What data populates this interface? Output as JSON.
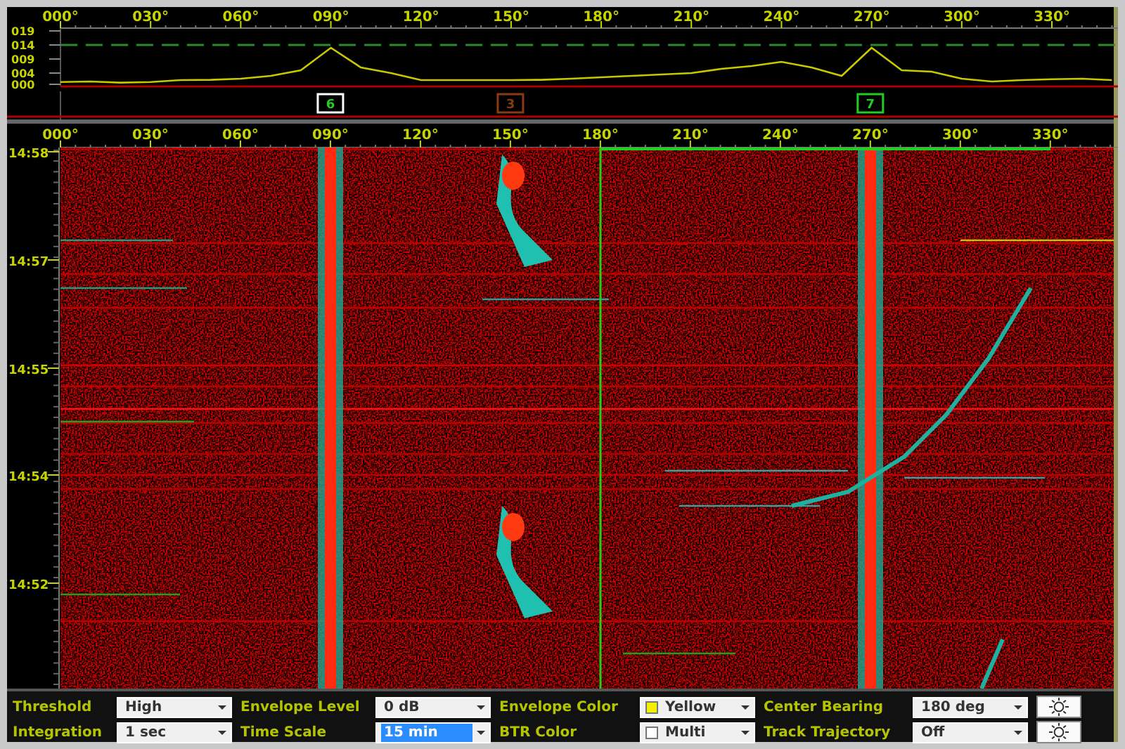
{
  "envelope": {
    "chart_data": {
      "type": "line",
      "x": [
        0,
        10,
        20,
        30,
        40,
        50,
        60,
        70,
        80,
        90,
        100,
        110,
        120,
        130,
        140,
        150,
        160,
        170,
        180,
        190,
        200,
        210,
        220,
        230,
        240,
        250,
        260,
        270,
        280,
        290,
        300,
        310,
        320,
        330,
        340,
        350
      ],
      "values": [
        0.8,
        1,
        0.6,
        0.8,
        1.5,
        1.6,
        2,
        3,
        5,
        13,
        6,
        4,
        1.5,
        1.5,
        1.5,
        1.5,
        1.6,
        2,
        2.5,
        3,
        3.5,
        4,
        5.5,
        6.5,
        8,
        6,
        3,
        13,
        5,
        4.5,
        2,
        1,
        1.5,
        1.8,
        2,
        1.5
      ],
      "xlim": [
        0,
        352
      ],
      "ylim": [
        0,
        19
      ],
      "xticks": [
        {
          "value": 0,
          "label": "000°"
        },
        {
          "value": 30,
          "label": "030°"
        },
        {
          "value": 60,
          "label": "060°"
        },
        {
          "value": 90,
          "label": "090°"
        },
        {
          "value": 120,
          "label": "120°"
        },
        {
          "value": 150,
          "label": "150°"
        },
        {
          "value": 180,
          "label": "180°"
        },
        {
          "value": 210,
          "label": "210°"
        },
        {
          "value": 240,
          "label": "240°"
        },
        {
          "value": 270,
          "label": "270°"
        },
        {
          "value": 300,
          "label": "300°"
        },
        {
          "value": 330,
          "label": "330°"
        }
      ],
      "yticks": [
        {
          "value": 19,
          "label": "019"
        },
        {
          "value": 14,
          "label": "014"
        },
        {
          "value": 9,
          "label": "009"
        },
        {
          "value": 4,
          "label": "004"
        },
        {
          "value": 0,
          "label": "000"
        }
      ],
      "ref_lines": [
        {
          "axis": "y",
          "value": 14
        }
      ]
    }
  },
  "track_markers": [
    {
      "label": "6",
      "color": "#22cc22",
      "selected": true
    },
    {
      "label": "3",
      "color": "#8a3a10",
      "selected": false
    },
    {
      "label": "7",
      "color": "#22cc22",
      "selected": false
    }
  ],
  "waterfall_bearing_scale": {
    "labels": [
      "000°",
      "030°",
      "060°",
      "090°",
      "120°",
      "150°",
      "180°",
      "210°",
      "240°",
      "270°",
      "300°",
      "330°"
    ]
  },
  "time_labels": [
    "14:58",
    "14:57",
    "14:55",
    "14:54",
    "14:52"
  ],
  "controls": [
    {
      "label": "Threshold",
      "value": "High",
      "highlighted": false
    },
    {
      "label": "Envelope Level",
      "value": "0 dB",
      "highlighted": false
    },
    {
      "label": "Envelope Color",
      "value": "Yellow",
      "color": "#f0f000",
      "highlighted": false
    },
    {
      "label": "Center Bearing",
      "value": "180 deg",
      "highlighted": false
    },
    {
      "label": "Integration",
      "value": "1 sec",
      "highlighted": false
    },
    {
      "label": "Time Scale",
      "value": "15 min",
      "highlighted": true
    },
    {
      "label": "BTR Color",
      "value": "Multi",
      "color": "#ffffff",
      "highlighted": false
    },
    {
      "label": "Track Trajectory",
      "value": "Off",
      "highlighted": false
    }
  ]
}
